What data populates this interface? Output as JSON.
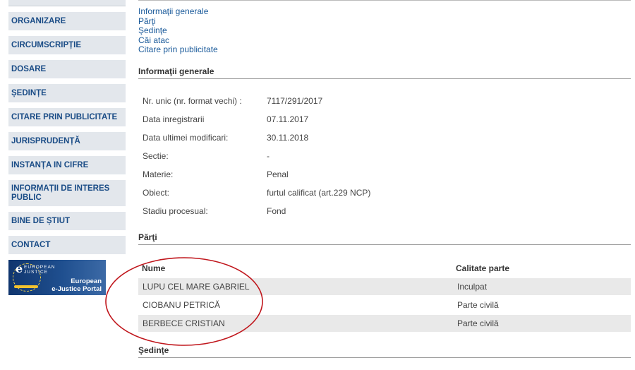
{
  "sidebar": {
    "items": [
      {
        "label": "ORGANIZARE"
      },
      {
        "label": "CIRCUMSCRIPȚIE"
      },
      {
        "label": "DOSARE"
      },
      {
        "label": "ȘEDINȚE"
      },
      {
        "label": "CITARE PRIN PUBLICITATE"
      },
      {
        "label": "JURISPRUDENȚĂ"
      },
      {
        "label": "INSTANȚA IN CIFRE"
      },
      {
        "label": "INFORMAȚII DE INTERES PUBLIC"
      },
      {
        "label": "BINE DE ȘTIUT"
      },
      {
        "label": "CONTACT"
      }
    ],
    "logo": {
      "eu_text": "EUROPEAN\nJUSTICE",
      "portal_text": "European\ne-Justice Portal"
    }
  },
  "toc": [
    "Informaţii generale",
    "Părţi",
    "Şedinţe",
    "Căi atac",
    "Citare prin publicitate"
  ],
  "general": {
    "heading": "Informaţii generale",
    "rows": [
      {
        "label": "Nr. unic (nr. format vechi) :",
        "value": "7117/291/2017"
      },
      {
        "label": "Data inregistrarii",
        "value": "07.11.2017"
      },
      {
        "label": "Data ultimei modificari:",
        "value": "30.11.2018"
      },
      {
        "label": "Sectie:",
        "value": "-"
      },
      {
        "label": "Materie:",
        "value": "Penal"
      },
      {
        "label": "Obiect:",
        "value": "furtul calificat (art.229 NCP)"
      },
      {
        "label": "Stadiu procesual:",
        "value": "Fond"
      }
    ]
  },
  "parties": {
    "heading": "Părţi",
    "col_name": "Nume",
    "col_role": "Calitate parte",
    "rows": [
      {
        "name": "LUPU CEL MARE GABRIEL",
        "role": "Inculpat"
      },
      {
        "name": "CIOBANU PETRICĂ",
        "role": "Parte civilă"
      },
      {
        "name": "BERBECE CRISTIAN",
        "role": "Parte civilă"
      }
    ]
  },
  "hearings": {
    "heading": "Şedinţe"
  },
  "colors": {
    "link": "#1a5a9a",
    "nav_text": "#1a4c86",
    "nav_bg": "#e3e7ec",
    "annotation": "#c0161c"
  }
}
